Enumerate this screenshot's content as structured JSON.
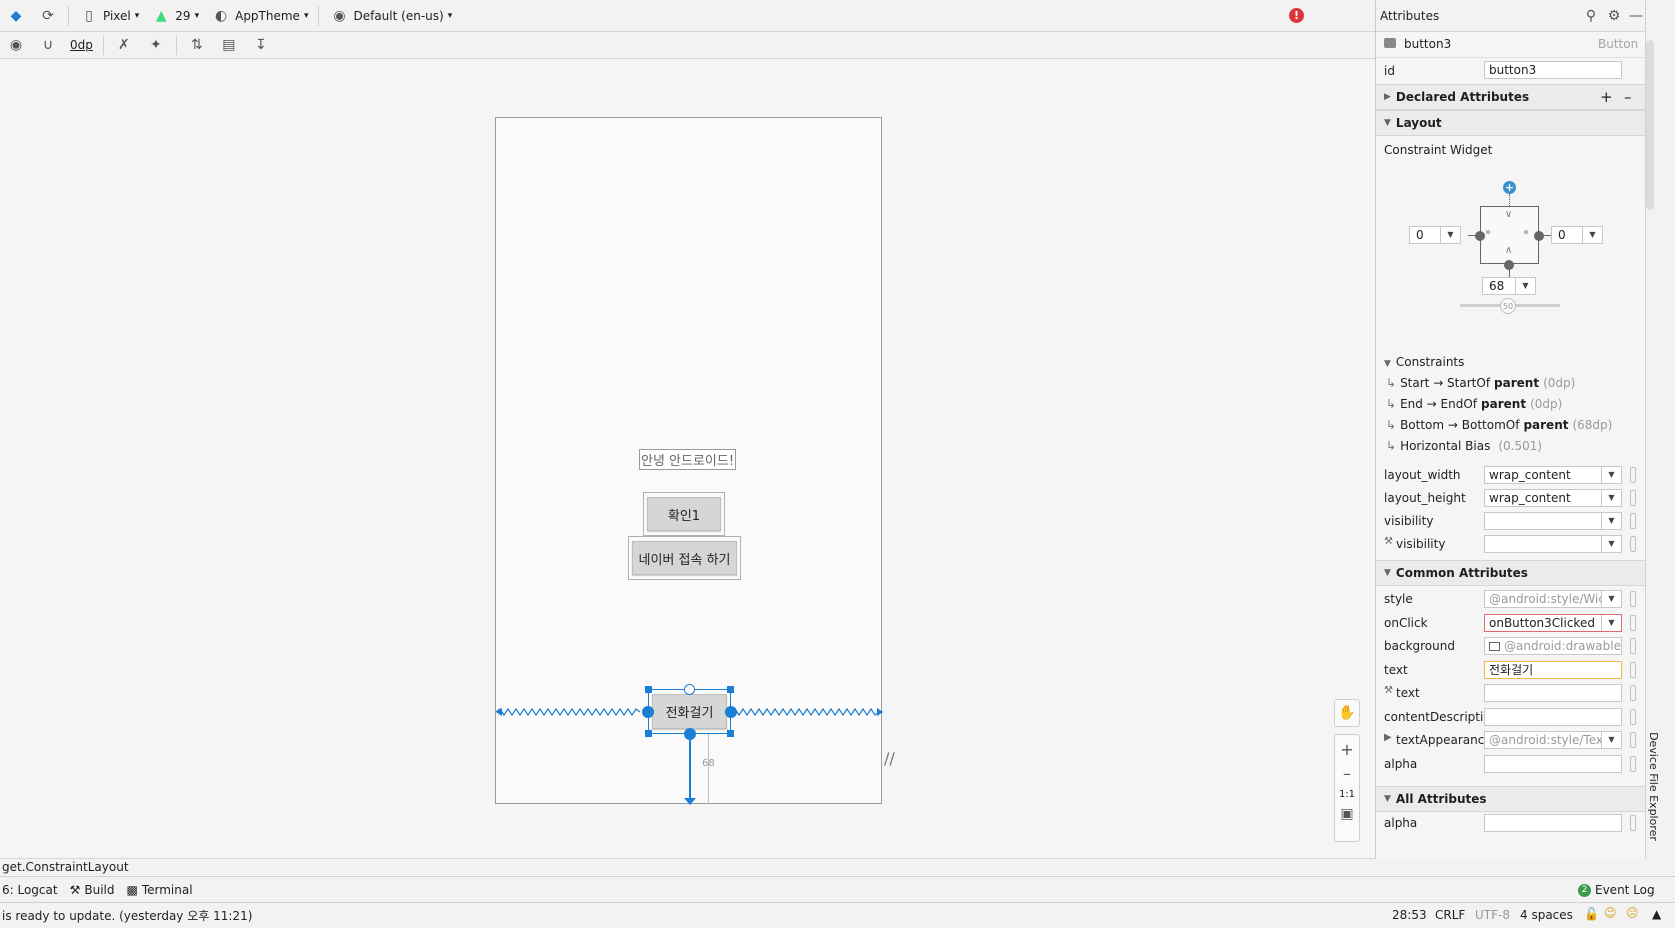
{
  "toolbar": {
    "device": "Pixel",
    "api": "29",
    "theme": "AppTheme",
    "locale": "Default (en-us)",
    "margin": "0dp"
  },
  "canvas": {
    "greeting": "안녕 안드로이드!",
    "button1": "확인1",
    "button2": "네이버 접속 하기",
    "button3": "전화걸기",
    "margin_label": "68",
    "zoom_reset": "1:1"
  },
  "panel": {
    "title": "Attributes",
    "component_name": "button3",
    "component_type": "Button",
    "id_label": "id",
    "id_value": "button3",
    "declared_attributes": "Declared Attributes",
    "layout": "Layout",
    "constraint_widget": "Constraint Widget",
    "left_margin": "0",
    "right_margin": "0",
    "bottom_margin": "68",
    "bias": "50",
    "constraints_header": "Constraints",
    "constraints": [
      {
        "a": "Start → StartOf ",
        "b": "parent",
        "c": " (0dp)"
      },
      {
        "a": "End → EndOf ",
        "b": "parent",
        "c": " (0dp)"
      },
      {
        "a": "Bottom → BottomOf ",
        "b": "parent",
        "c": " (68dp)"
      },
      {
        "a": "Horizontal Bias ",
        "b": "",
        "c": " (0.501)"
      }
    ],
    "layout_rows": [
      {
        "label": "layout_width",
        "value": "wrap_content"
      },
      {
        "label": "layout_height",
        "value": "wrap_content"
      },
      {
        "label": "visibility",
        "value": ""
      },
      {
        "label": "visibility",
        "value": ""
      }
    ],
    "common_attributes": "Common Attributes",
    "common_rows": [
      {
        "label": "style",
        "value": "@android:style/Wic"
      },
      {
        "label": "onClick",
        "value": "onButton3Clicked"
      },
      {
        "label": "background",
        "value": "@android:drawable/b"
      },
      {
        "label": "text",
        "value": "전화걸기"
      },
      {
        "label": "text",
        "value": ""
      },
      {
        "label": "contentDescription",
        "value": ""
      },
      {
        "label": "textAppearance",
        "value": "@android:style/Tex"
      },
      {
        "label": "alpha",
        "value": ""
      }
    ],
    "all_attributes": "All Attributes",
    "all_rows": [
      {
        "label": "alpha",
        "value": ""
      }
    ]
  },
  "right_strip": {
    "label": "Device File Explorer"
  },
  "breadcrumb": "get.ConstraintLayout",
  "bottom_tabs": {
    "logcat": "6: Logcat",
    "build": "Build",
    "terminal": "Terminal",
    "event_log": "Event Log"
  },
  "status": {
    "message": "is ready to update. (yesterday 오후 11:21)",
    "position": "28:53",
    "line_sep": "CRLF",
    "encoding": "UTF-8",
    "indent": "4 spaces"
  },
  "colors": {
    "accent": "#1a7fd4",
    "error": "#d9363e",
    "selection_border": "#e0686e",
    "text_highlight": "#f0b84a"
  }
}
